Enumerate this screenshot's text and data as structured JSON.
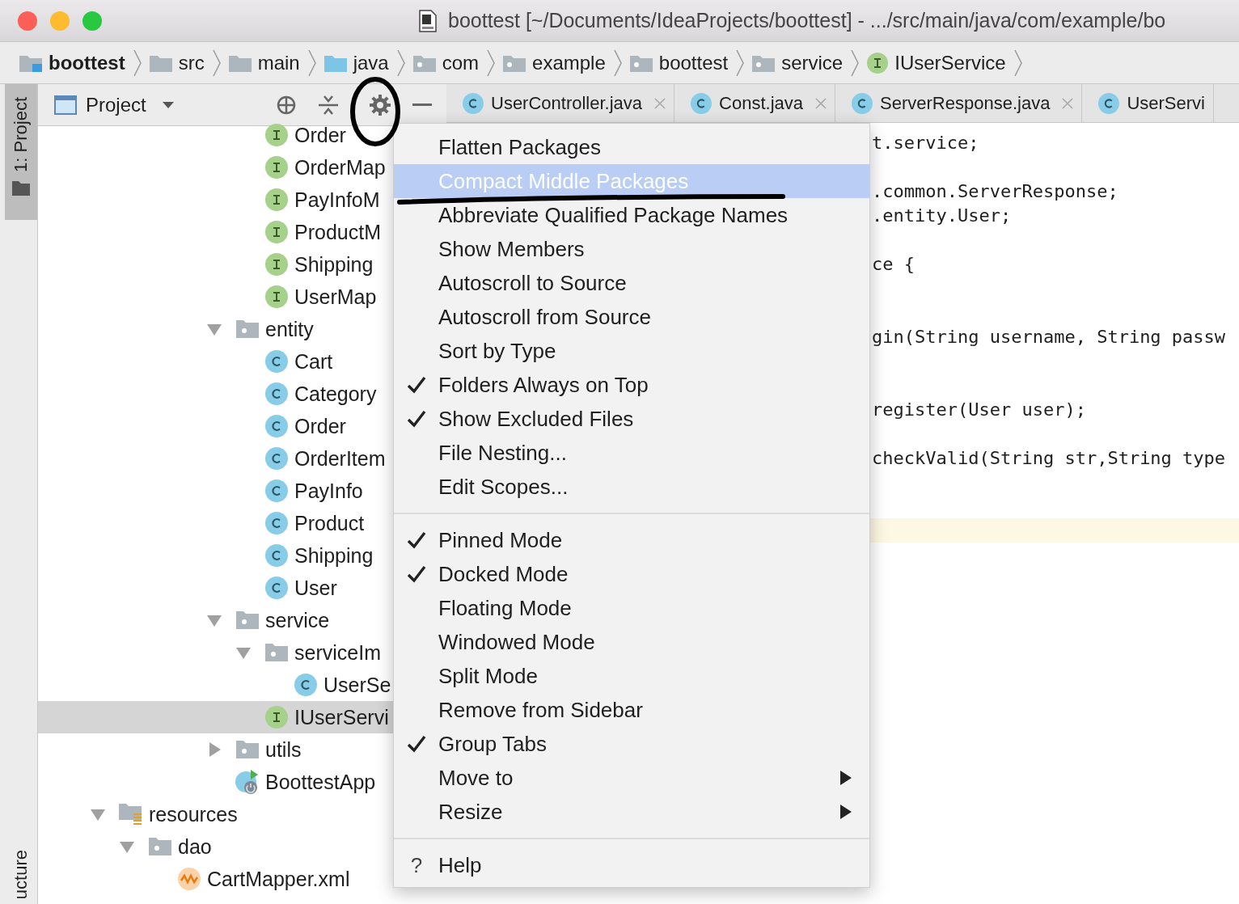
{
  "window": {
    "title": "boottest [~/Documents/IdeaProjects/boottest] - .../src/main/java/com/example/bo"
  },
  "breadcrumbs": [
    {
      "label": "boottest",
      "kind": "module"
    },
    {
      "label": "src",
      "kind": "folder"
    },
    {
      "label": "main",
      "kind": "folder"
    },
    {
      "label": "java",
      "kind": "source"
    },
    {
      "label": "com",
      "kind": "package"
    },
    {
      "label": "example",
      "kind": "package"
    },
    {
      "label": "boottest",
      "kind": "package"
    },
    {
      "label": "service",
      "kind": "package"
    },
    {
      "label": "IUserService",
      "kind": "interface"
    }
  ],
  "tool_stripe": {
    "top": {
      "label": "1: Project",
      "selected": true
    },
    "bottom": {
      "label": "ucture"
    }
  },
  "project_panel": {
    "title": "Project",
    "tree": [
      {
        "children": [
          {
            "children": [
              {
                "children": [
                  {
                    "children": [
                      {
                        "children": [
                          {
                            "label": "Order",
                            "kind": "interface",
                            "selected": false
                          },
                          {
                            "label": "OrderMap",
                            "kind": "interface",
                            "selected": false
                          },
                          {
                            "label": "PayInfoM",
                            "kind": "interface",
                            "selected": false
                          },
                          {
                            "label": "ProductM",
                            "kind": "interface",
                            "selected": false
                          },
                          {
                            "label": "Shipping",
                            "kind": "interface",
                            "selected": false
                          },
                          {
                            "label": "UserMap",
                            "kind": "interface",
                            "selected": false
                          }
                        ]
                      },
                      {
                        "label": "entity",
                        "kind": "package",
                        "expanded": true,
                        "selected": false,
                        "children": [
                          {
                            "label": "Cart",
                            "kind": "class",
                            "selected": false
                          },
                          {
                            "label": "Category",
                            "kind": "class",
                            "selected": false
                          },
                          {
                            "label": "Order",
                            "kind": "class",
                            "selected": false
                          },
                          {
                            "label": "OrderItem",
                            "kind": "class",
                            "selected": false
                          },
                          {
                            "label": "PayInfo",
                            "kind": "class",
                            "selected": false
                          },
                          {
                            "label": "Product",
                            "kind": "class",
                            "selected": false
                          },
                          {
                            "label": "Shipping",
                            "kind": "class",
                            "selected": false
                          },
                          {
                            "label": "User",
                            "kind": "class",
                            "selected": false
                          }
                        ]
                      },
                      {
                        "label": "service",
                        "kind": "package",
                        "expanded": true,
                        "selected": false,
                        "children": [
                          {
                            "label": "serviceIm",
                            "kind": "package",
                            "expanded": true,
                            "selected": false,
                            "children": [
                              {
                                "label": "UserSe",
                                "kind": "class",
                                "selected": false
                              }
                            ]
                          },
                          {
                            "label": "IUserServi",
                            "kind": "interface",
                            "selected": true
                          }
                        ]
                      },
                      {
                        "label": "utils",
                        "kind": "package",
                        "expanded": false,
                        "selected": false
                      },
                      {
                        "label": "BoottestApp",
                        "kind": "spring",
                        "selected": false
                      }
                    ]
                  }
                ]
              }
            ]
          }
        ]
      },
      {
        "label": "resources",
        "kind": "resources",
        "expanded": true,
        "selected": false,
        "children": [
          {
            "label": "dao",
            "kind": "package",
            "expanded": true,
            "selected": false,
            "children": [
              {
                "label": "CartMapper.xml",
                "kind": "xml",
                "selected": false
              }
            ]
          }
        ]
      }
    ]
  },
  "tabs": [
    {
      "label": "UserController.java",
      "closable": true
    },
    {
      "label": "Const.java",
      "closable": true
    },
    {
      "label": "ServerResponse.java",
      "closable": true
    },
    {
      "label": "UserServi",
      "closable": false
    }
  ],
  "editor": {
    "lines": [
      {
        "kind": "code",
        "text": "t.service;"
      },
      {
        "kind": "blank"
      },
      {
        "kind": "code",
        "text": ".common.ServerResponse;"
      },
      {
        "kind": "code",
        "text": ".entity.User;"
      },
      {
        "kind": "blank"
      },
      {
        "kind": "code",
        "text": "ce {"
      },
      {
        "kind": "blank"
      },
      {
        "kind": "blank"
      },
      {
        "kind": "code",
        "text": "gin(String username, String passw"
      },
      {
        "kind": "blank"
      },
      {
        "kind": "blank"
      },
      {
        "kind": "code",
        "text": "register(User user);"
      },
      {
        "kind": "blank"
      },
      {
        "kind": "code",
        "text": "checkValid(String str,String type"
      },
      {
        "kind": "blank"
      },
      {
        "kind": "blank"
      },
      {
        "kind": "current"
      }
    ]
  },
  "menu": [
    {
      "kind": "item",
      "label": "Flatten Packages",
      "checked": false,
      "selected": false
    },
    {
      "kind": "item",
      "label": "Compact Middle Packages",
      "checked": false,
      "selected": true
    },
    {
      "kind": "item",
      "label": "Abbreviate Qualified Package Names",
      "checked": false,
      "selected": false
    },
    {
      "kind": "item",
      "label": "Show Members",
      "checked": false,
      "selected": false
    },
    {
      "kind": "item",
      "label": "Autoscroll to Source",
      "checked": false,
      "selected": false
    },
    {
      "kind": "item",
      "label": "Autoscroll from Source",
      "checked": false,
      "selected": false
    },
    {
      "kind": "item",
      "label": "Sort by Type",
      "checked": false,
      "selected": false
    },
    {
      "kind": "item",
      "label": "Folders Always on Top",
      "checked": true,
      "selected": false
    },
    {
      "kind": "item",
      "label": "Show Excluded Files",
      "checked": true,
      "selected": false
    },
    {
      "kind": "item",
      "label": "File Nesting...",
      "checked": false,
      "selected": false
    },
    {
      "kind": "item",
      "label": "Edit Scopes...",
      "checked": false,
      "selected": false
    },
    {
      "kind": "separator"
    },
    {
      "kind": "item",
      "label": "Pinned Mode",
      "checked": true,
      "selected": false
    },
    {
      "kind": "item",
      "label": "Docked Mode",
      "checked": true,
      "selected": false
    },
    {
      "kind": "item",
      "label": "Floating Mode",
      "checked": false,
      "selected": false
    },
    {
      "kind": "item",
      "label": "Windowed Mode",
      "checked": false,
      "selected": false
    },
    {
      "kind": "item",
      "label": "Split Mode",
      "checked": false,
      "selected": false
    },
    {
      "kind": "item",
      "label": "Remove from Sidebar",
      "checked": false,
      "selected": false
    },
    {
      "kind": "item",
      "label": "Group Tabs",
      "checked": true,
      "selected": false
    },
    {
      "kind": "submenu",
      "label": "Move to",
      "checked": false,
      "selected": false
    },
    {
      "kind": "submenu",
      "label": "Resize",
      "checked": false,
      "selected": false
    },
    {
      "kind": "separator"
    },
    {
      "kind": "help",
      "icon_text": "?",
      "label": "Help",
      "checked": false,
      "selected": false
    }
  ]
}
